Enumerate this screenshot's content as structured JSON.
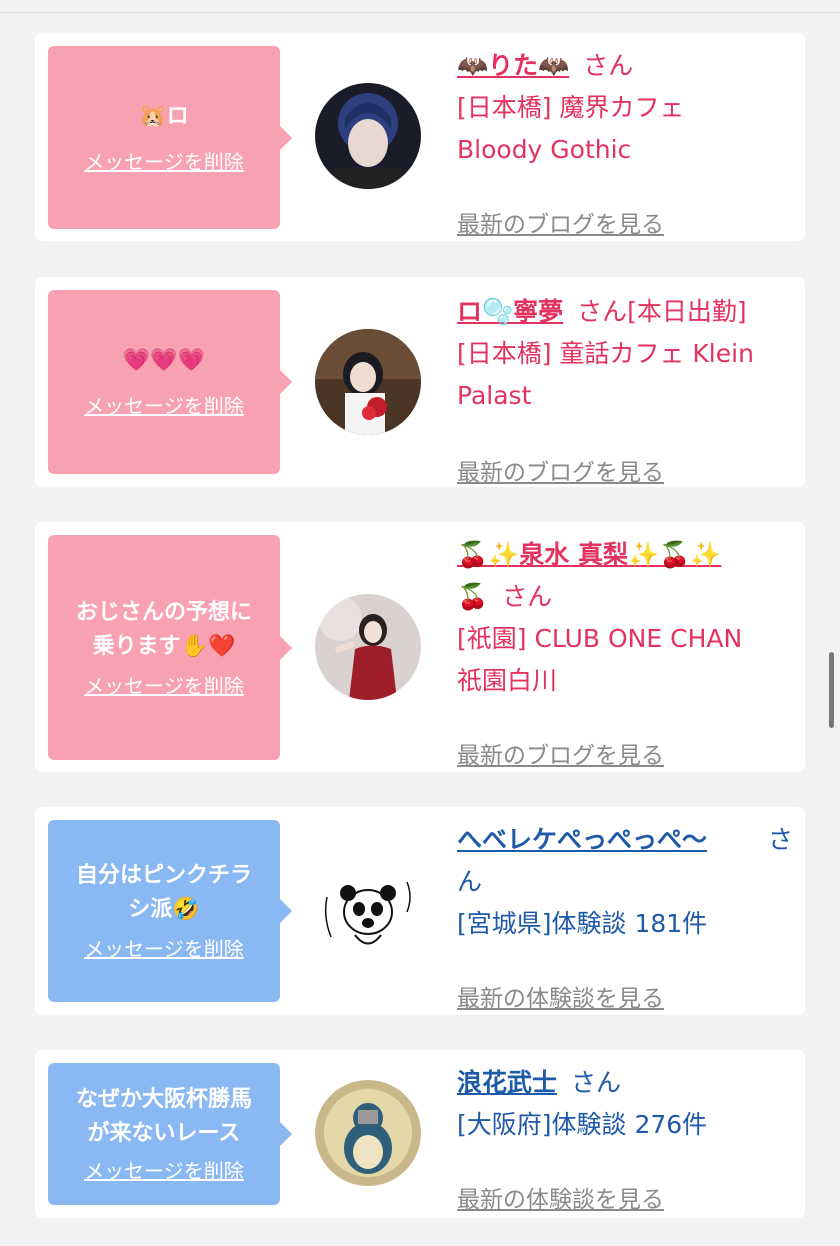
{
  "cards": [
    {
      "bubble_text": "🐹ロ",
      "delete_label": "メッセージを削除",
      "name": "🦇りた🦇",
      "honorific": "さん",
      "shop_line1": "[日本橋] 魔界カフェ",
      "shop_line2": "Bloody Gothic",
      "blog_link": "最新のブログを見る"
    },
    {
      "bubble_text": "💗💗💗",
      "delete_label": "メッセージを削除",
      "name": "ロ🫧寧夢",
      "honorific": "さん",
      "status": "[本日出勤]",
      "shop_line1": "[日本橋] 童話カフェ Klein",
      "shop_line2": "Palast",
      "blog_link": "最新のブログを見る"
    },
    {
      "bubble_line1": "おじさんの予想に",
      "bubble_line2": "乗ります✋❤️",
      "delete_label": "メッセージを削除",
      "name_line1": "🍒✨泉水 真梨✨🍒✨",
      "name_line2": "🍒",
      "honorific": "さん",
      "shop_line1": "[祇園] CLUB ONE CHAN",
      "shop_line2": "祇園白川",
      "blog_link": "最新のブログを見る"
    },
    {
      "bubble_line1": "自分はピンクチラ",
      "bubble_line2": "シ派🤣",
      "delete_label": "メッセージを削除",
      "name": "へべレケぺっぺっぺ〜",
      "honorific_line1": "さ",
      "honorific_line2": "ん",
      "shop_line1": "[宮城県]体験談 181件",
      "blog_link": "最新の体験談を見る"
    },
    {
      "bubble_line1": "なぜか大阪杯勝馬",
      "bubble_line2": "が来ないレース",
      "delete_label": "メッセージを削除",
      "name": "浪花武士",
      "honorific": "さん",
      "shop_line1": "[大阪府]体験談 276件",
      "blog_link": "最新の体験談を見る"
    }
  ],
  "colors": {
    "pink_bubble": "#f8a1b0",
    "blue_bubble": "#8ab8f2",
    "pink_text": "#e3325e",
    "blue_text": "#1f5aa8",
    "link_gray": "#8a8a8a"
  }
}
